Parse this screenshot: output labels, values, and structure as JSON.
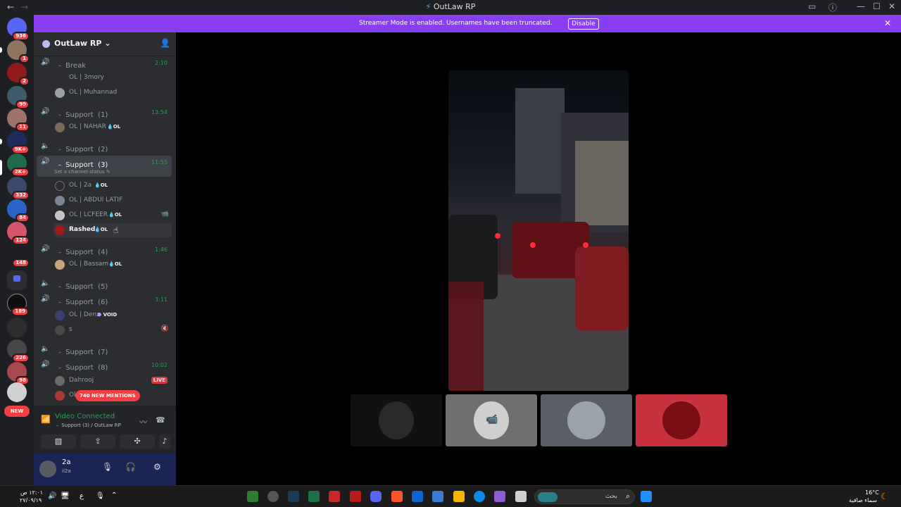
{
  "window": {
    "title": "OutLaw RP",
    "back": "←",
    "forward": "→"
  },
  "banner": {
    "message": "Streamer Mode is enabled. Usernames have been truncated.",
    "disable_label": "Disable",
    "close": "✕"
  },
  "servers": {
    "badges": [
      "936",
      "1",
      "2",
      "99",
      "11",
      "9K+",
      "2K+",
      "332",
      "84",
      "124",
      "148",
      "189",
      "226",
      "98"
    ],
    "new_label": "NEW"
  },
  "guild": {
    "name": "OutLaw RP",
    "chevron": "⌄"
  },
  "channels": [
    {
      "name": "﹣ Break",
      "time": "2:10"
    },
    {
      "name": "﹣ Support  (1)",
      "time": "13:54"
    },
    {
      "name": "﹣ Support  (2)"
    },
    {
      "name": "﹣ Support  (3)",
      "time": "11:55",
      "status": "Set a channel status ✎"
    },
    {
      "name": "﹣ Support  (4)",
      "time": "1:46"
    },
    {
      "name": "﹣ Support  (5)"
    },
    {
      "name": "﹣ Support  (6)",
      "time": "3:11"
    },
    {
      "name": "﹣ Support  (7)"
    },
    {
      "name": "﹣ Support  (8)",
      "time": "10:02"
    }
  ],
  "users": [
    {
      "name": "OL | 3mory"
    },
    {
      "name": "OL | Muhannad"
    },
    {
      "name": "OL | NAHAR",
      "tag": "OL"
    },
    {
      "name": "OL | 2a",
      "tag": "OL"
    },
    {
      "name": "OL | ABDUl LATIF"
    },
    {
      "name": "OL | LCFEER",
      "tag": "OL"
    },
    {
      "name": "Rashed",
      "tag": "OL"
    },
    {
      "name": "OL | Bassam",
      "tag": "OL"
    },
    {
      "name": "OL | Denz",
      "tag": "VOID"
    },
    {
      "name": "s"
    },
    {
      "name": "Dahrooj",
      "live": "LIVE"
    },
    {
      "name": "Ol"
    }
  ],
  "mentions": "740 NEW MENTIONS",
  "voice": {
    "status": "Video Connected",
    "channel": "﹣ Support  (3)  / OutLaw RP"
  },
  "user": {
    "name": "2a",
    "sub": "ii2a"
  },
  "taskbar": {
    "time": "١٢:٠١ ص",
    "date": "٢٧/٠٩/١٩",
    "lang": "ع",
    "search_placeholder": "بحث",
    "temp": "16°C",
    "weather": "سماء صافية"
  }
}
